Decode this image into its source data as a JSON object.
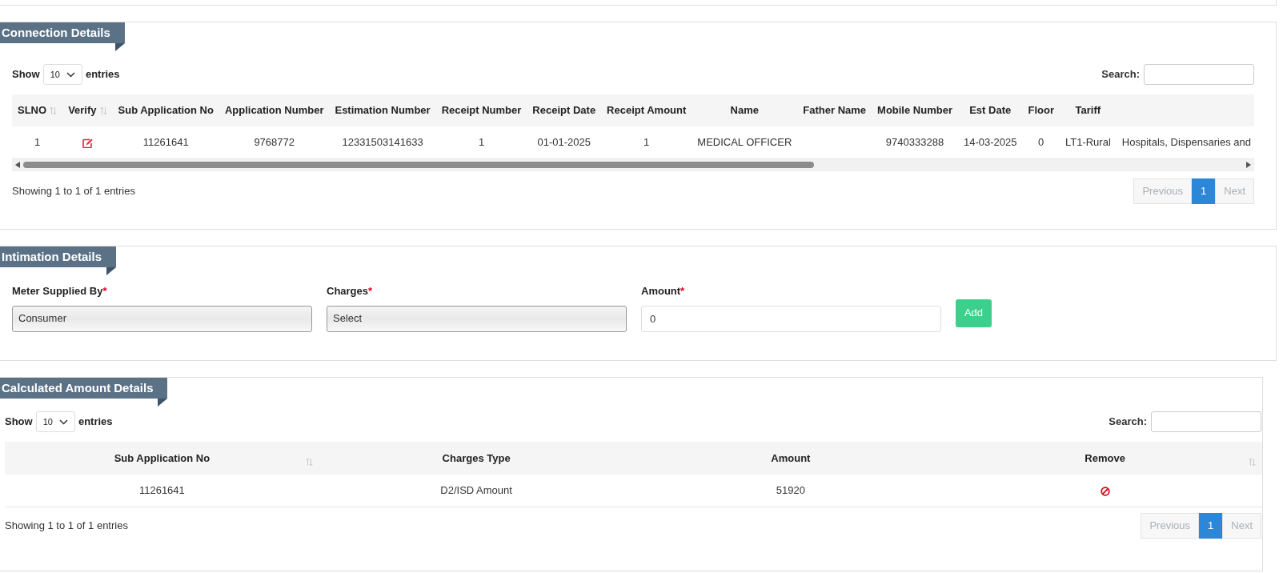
{
  "connection": {
    "title": "Connection Details",
    "show_label": "Show",
    "page_size": "10",
    "entries_label": "entries",
    "search_label": "Search:",
    "columns": [
      {
        "label": "SLNO",
        "sort_icon": true
      },
      {
        "label": "Verify",
        "sort_icon": true
      },
      {
        "label": "Sub Application No",
        "sort_icon": false
      },
      {
        "label": "Application Number",
        "sort_icon": false
      },
      {
        "label": "Estimation Number",
        "sort_icon": false
      },
      {
        "label": "Receipt Number",
        "sort_icon": false
      },
      {
        "label": "Receipt Date",
        "sort_icon": false
      },
      {
        "label": "Receipt Amount",
        "sort_icon": false
      },
      {
        "label": "Name",
        "sort_icon": false
      },
      {
        "label": "Father Name",
        "sort_icon": false
      },
      {
        "label": "Mobile Number",
        "sort_icon": false
      },
      {
        "label": "Est Date",
        "sort_icon": false
      },
      {
        "label": "Floor",
        "sort_icon": false
      },
      {
        "label": "Tariff",
        "sort_icon": false
      }
    ],
    "rows": [
      {
        "cells": [
          {
            "kind": "text",
            "text": "1"
          },
          {
            "kind": "edit_icon"
          },
          {
            "kind": "text",
            "text": "11261641"
          },
          {
            "kind": "text",
            "text": "9768772"
          },
          {
            "kind": "text",
            "text": "12331503141633"
          },
          {
            "kind": "text",
            "text": "1"
          },
          {
            "kind": "text",
            "text": "01-01-2025"
          },
          {
            "kind": "text",
            "text": "1"
          },
          {
            "kind": "text",
            "text": "MEDICAL OFFICER"
          },
          {
            "kind": "text",
            "text": ""
          },
          {
            "kind": "text",
            "text": "9740333288"
          },
          {
            "kind": "text",
            "text": "14-03-2025"
          },
          {
            "kind": "text",
            "text": "0"
          },
          {
            "kind": "text",
            "text": "LT1-Rural"
          },
          {
            "kind": "text",
            "text": "Hospitals, Dispensaries and"
          }
        ]
      }
    ],
    "info": "Showing 1 to 1 of 1 entries",
    "pagination": [
      {
        "label": "Previous",
        "disabled": true,
        "selected": false
      },
      {
        "label": "1",
        "disabled": false,
        "selected": true
      },
      {
        "label": "Next",
        "disabled": true,
        "selected": false
      }
    ]
  },
  "intimation": {
    "title": "Intimation Details",
    "fields": [
      {
        "kind": "select",
        "label": "Meter Supplied By",
        "required_mark": "*",
        "value": "Consumer"
      },
      {
        "kind": "select",
        "label": "Charges",
        "required_mark": "*",
        "value": "Select"
      },
      {
        "kind": "input",
        "label": "Amount",
        "required_mark": "*",
        "value": "0"
      }
    ],
    "add_button": "Add"
  },
  "calculated": {
    "title": "Calculated Amount Details",
    "show_label": "Show",
    "page_size": "10",
    "entries_label": "entries",
    "search_label": "Search:",
    "columns": [
      {
        "label": "Sub Application No",
        "sort_icon": true
      },
      {
        "label": "Charges Type",
        "sort_icon": false
      },
      {
        "label": "Amount",
        "sort_icon": false
      },
      {
        "label": "Remove",
        "sort_icon": true
      }
    ],
    "rows": [
      {
        "cells": [
          {
            "kind": "text",
            "text": "11261641"
          },
          {
            "kind": "text",
            "text": "D2/ISD Amount"
          },
          {
            "kind": "text",
            "text": "51920"
          },
          {
            "kind": "remove_icon"
          }
        ]
      }
    ],
    "info": "Showing 1 to 1 of 1 entries",
    "pagination": [
      {
        "label": "Previous",
        "disabled": true,
        "selected": false
      },
      {
        "label": "1",
        "disabled": false,
        "selected": true
      },
      {
        "label": "Next",
        "disabled": true,
        "selected": false
      }
    ]
  }
}
